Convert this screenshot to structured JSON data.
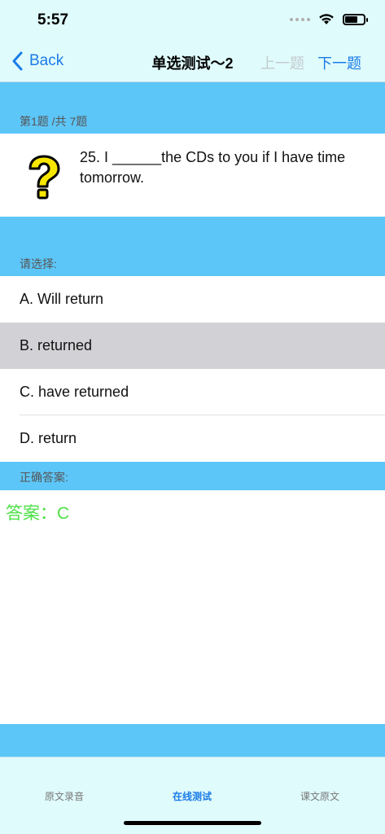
{
  "status": {
    "time": "5:57"
  },
  "nav": {
    "back_label": "Back",
    "title": "单选测试～2",
    "prev_label": "上一题",
    "next_label": "下一题"
  },
  "question": {
    "counter": "第1题 /共 7题",
    "text": "25. I ______the CDs to you if I have time tomorrow."
  },
  "choose_label": "请选择:",
  "options": [
    {
      "label": "A. Will return",
      "selected": false
    },
    {
      "label": "B. returned",
      "selected": true
    },
    {
      "label": "C. have returned",
      "selected": false
    },
    {
      "label": "D. return",
      "selected": false
    }
  ],
  "answer": {
    "section_label": "正确答案:",
    "text": "答案：C",
    "color": "#4fe047"
  },
  "tabs": [
    {
      "label": "原文录音",
      "active": false
    },
    {
      "label": "在线测试",
      "active": true
    },
    {
      "label": "课文原文",
      "active": false
    }
  ],
  "colors": {
    "accent": "#1a7ce8",
    "band": "#5dc6f8",
    "bar_bg": "#e0fbfc",
    "selected_bg": "#d2d2d6"
  }
}
